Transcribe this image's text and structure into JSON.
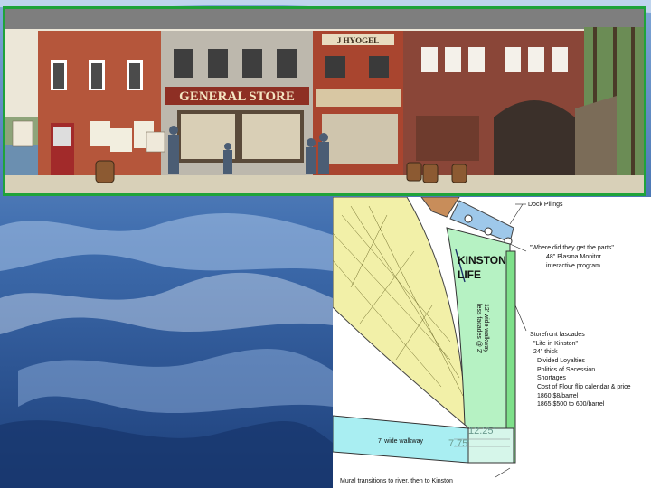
{
  "mural": {
    "general_store_sign": "GENERAL STORE",
    "shop_sign": "J HYOGEL"
  },
  "floor_plan": {
    "dock_pilings_label": "Dock Pilings",
    "kinston_life_line1": "KINSTON",
    "kinston_life_line2": "LIFE",
    "parts_question": "\"Where did they get the parts\"",
    "plasma_monitor": "48\" Plasma Monitor",
    "interactive_program": "interactive program",
    "walkway_12_line1": "12' wide walkway",
    "walkway_12_line2": "less facades @ 2'",
    "storefront_fascades": "Storefront fascades",
    "life_in_kinston": "\"Life in Kinston\"",
    "thickness": "24\" thick",
    "topics": [
      "Divided Loyalties",
      "Politics of Secession",
      "Shortages",
      "Cost of Flour flip calendar & price",
      "1860 $8/barrel",
      "1865 $500 to 600/barrel"
    ],
    "dim_12_25": "12.25'",
    "dim_7_75": "7.75'",
    "walkway_7": "7' wide walkway",
    "mural_transitions": "Mural transitions to river, then to Kinston"
  }
}
